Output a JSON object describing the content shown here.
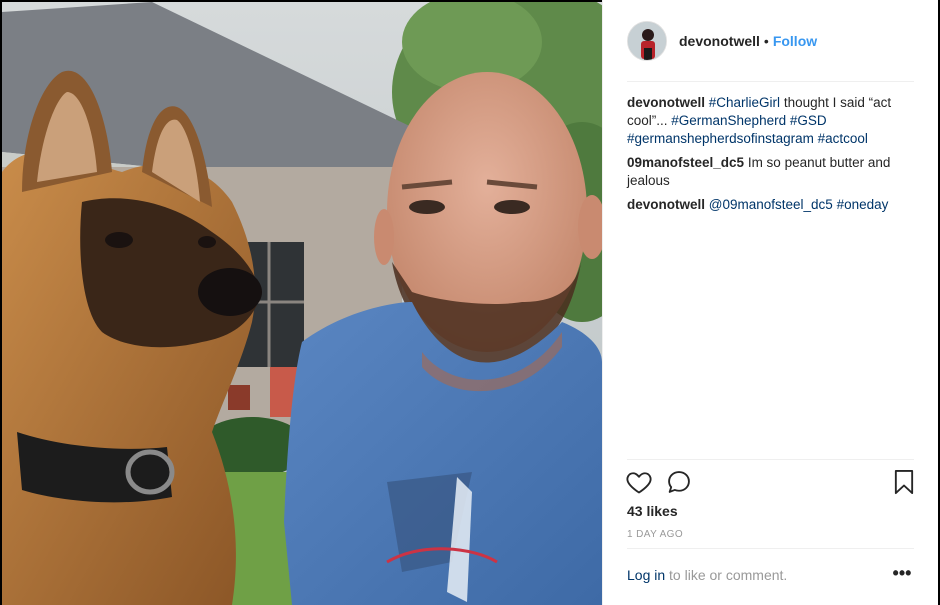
{
  "post": {
    "username": "devonotwell",
    "separator": "•",
    "follow_label": "Follow"
  },
  "comments": [
    {
      "user": "devonotwell",
      "parts": [
        {
          "t": " ",
          "tag": false
        },
        {
          "t": "#CharlieGirl",
          "tag": true
        },
        {
          "t": " thought I said “act cool”... ",
          "tag": false
        },
        {
          "t": "#GermanShepherd",
          "tag": true
        },
        {
          "t": " ",
          "tag": false
        },
        {
          "t": "#GSD",
          "tag": true
        },
        {
          "t": " ",
          "tag": false
        },
        {
          "t": "#germanshepherdsofinstagram",
          "tag": true
        },
        {
          "t": " ",
          "tag": false
        },
        {
          "t": "#actcool",
          "tag": true
        }
      ]
    },
    {
      "user": "09manofsteel_dc5",
      "parts": [
        {
          "t": " Im so peanut butter and jealous",
          "tag": false
        }
      ]
    },
    {
      "user": "devonotwell",
      "parts": [
        {
          "t": " ",
          "tag": false
        },
        {
          "t": "@09manofsteel_dc5",
          "tag": true
        },
        {
          "t": " ",
          "tag": false
        },
        {
          "t": "#oneday",
          "tag": true
        }
      ]
    }
  ],
  "engagement": {
    "likes": "43 likes",
    "time": "1 DAY AGO"
  },
  "footer": {
    "login_link": "Log in",
    "login_rest": " to like or comment.",
    "more_label": "•••"
  },
  "colors": {
    "link": "#3897f0",
    "hashtag": "#003569",
    "text": "#262626",
    "muted": "#999999"
  },
  "icons": {
    "like": "heart-icon",
    "comment": "comment-bubble-icon",
    "save": "bookmark-icon",
    "more": "more-options-icon"
  }
}
